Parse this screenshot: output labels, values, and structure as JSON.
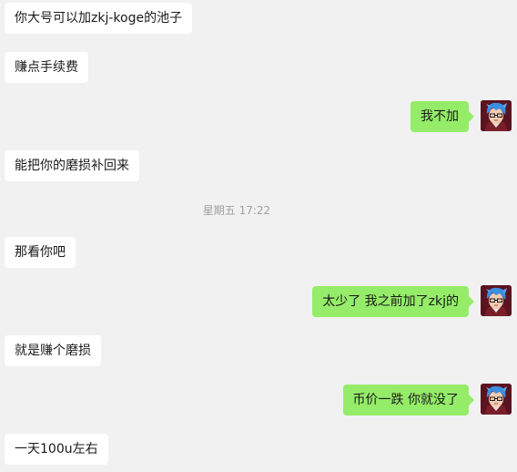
{
  "messages": [
    {
      "direction": "in",
      "text": "你大号可以加zkj-koge的池子"
    },
    {
      "direction": "in",
      "text": "赚点手续费"
    },
    {
      "direction": "out",
      "text": "我不加"
    },
    {
      "direction": "in",
      "text": "能把你的磨损补回来"
    },
    {
      "direction": "in",
      "text": "那看你吧"
    },
    {
      "direction": "out",
      "text": "太少了 我之前加了zkj的"
    },
    {
      "direction": "in",
      "text": "就是赚个磨损"
    },
    {
      "direction": "out",
      "text": "币价一跌 你就没了"
    },
    {
      "direction": "in",
      "text": "一天100u左右"
    }
  ],
  "timestamp": "星期五 17:22",
  "colors": {
    "background": "#f1f1f1",
    "incoming_bubble": "#ffffff",
    "outgoing_bubble": "#95ec69",
    "timestamp_text": "#a0a0a0"
  },
  "avatar": {
    "icon": "anime-avatar-blue-hair-glasses-icon"
  }
}
